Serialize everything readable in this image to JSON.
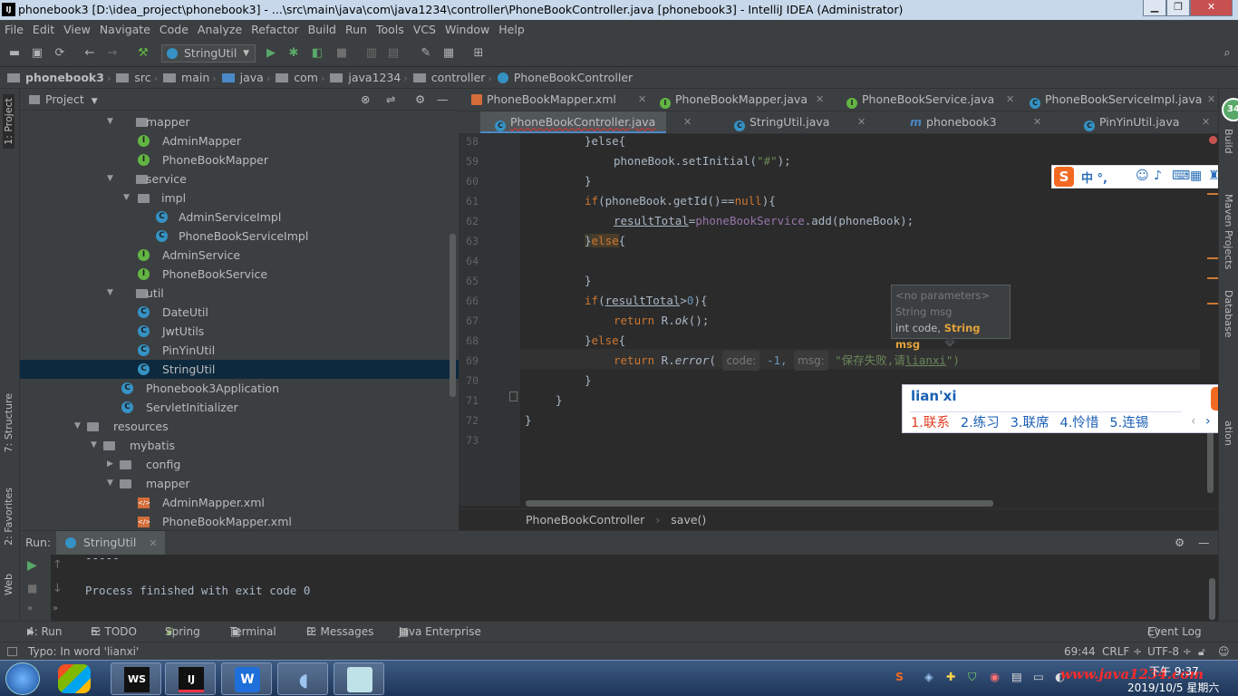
{
  "window": {
    "title": "phonebook3 [D:\\idea_project\\phonebook3] - ...\\src\\main\\java\\com\\java1234\\controller\\PhoneBookController.java [phonebook3] - IntelliJ IDEA (Administrator)"
  },
  "menu": [
    "File",
    "Edit",
    "View",
    "Navigate",
    "Code",
    "Analyze",
    "Refactor",
    "Build",
    "Run",
    "Tools",
    "VCS",
    "Window",
    "Help"
  ],
  "toolbar": {
    "run_config": "StringUtil"
  },
  "navbar": [
    "phonebook3",
    "src",
    "main",
    "java",
    "com",
    "java1234",
    "controller",
    "PhoneBookController"
  ],
  "left_strip": {
    "project": "1: Project",
    "structure": "7: Structure",
    "favorites": "2: Favorites",
    "web": "Web"
  },
  "right_strip": {
    "build": "Build",
    "maven": "Maven Projects",
    "database": "Database",
    "badge": "34",
    "other": "ation"
  },
  "project": {
    "header": "Project",
    "tree": [
      {
        "label": "mapper",
        "kind": "folder"
      },
      {
        "label": "AdminMapper",
        "kind": "interface"
      },
      {
        "label": "PhoneBookMapper",
        "kind": "interface"
      },
      {
        "label": "service",
        "kind": "folder"
      },
      {
        "label": "impl",
        "kind": "folder"
      },
      {
        "label": "AdminServiceImpl",
        "kind": "class"
      },
      {
        "label": "PhoneBookServiceImpl",
        "kind": "class"
      },
      {
        "label": "AdminService",
        "kind": "interface"
      },
      {
        "label": "PhoneBookService",
        "kind": "interface"
      },
      {
        "label": "util",
        "kind": "folder"
      },
      {
        "label": "DateUtil",
        "kind": "class"
      },
      {
        "label": "JwtUtils",
        "kind": "class"
      },
      {
        "label": "PinYinUtil",
        "kind": "class"
      },
      {
        "label": "StringUtil",
        "kind": "class"
      },
      {
        "label": "Phonebook3Application",
        "kind": "class"
      },
      {
        "label": "ServletInitializer",
        "kind": "class"
      },
      {
        "label": "resources",
        "kind": "folder"
      },
      {
        "label": "mybatis",
        "kind": "folder"
      },
      {
        "label": "config",
        "kind": "folder"
      },
      {
        "label": "mapper",
        "kind": "folder"
      },
      {
        "label": "AdminMapper.xml",
        "kind": "xml"
      },
      {
        "label": "PhoneBookMapper.xml",
        "kind": "xml"
      }
    ]
  },
  "tabs_row1": [
    {
      "label": "PhoneBookMapper.xml"
    },
    {
      "label": "PhoneBookMapper.java"
    },
    {
      "label": "PhoneBookService.java"
    },
    {
      "label": "PhoneBookServiceImpl.java"
    }
  ],
  "tabs_row2": [
    {
      "label": "PhoneBookController.java"
    },
    {
      "label": "StringUtil.java"
    },
    {
      "label": "phonebook3"
    },
    {
      "label": "PinYinUtil.java"
    }
  ],
  "code": {
    "line_numbers": [
      "58",
      "59",
      "60",
      "61",
      "62",
      "63",
      "64",
      "65",
      "66",
      "67",
      "68",
      "69",
      "70",
      "71",
      "72",
      "73"
    ],
    "l58": "}else{",
    "l59_a": "phoneBook.setInitial(",
    "l59_s": "\"#\"",
    "l59_b": ");",
    "l60": "}",
    "l61_kw": "if",
    "l61_a": "(phoneBook.getId()==",
    "l61_null": "null",
    "l61_b": "){",
    "l62_f": "resultTotal",
    "l62_a": "=",
    "l62_f2": "phoneBookService",
    "l62_b": ".add(phoneBook);",
    "l63_a": "}",
    "l63_kw": "else",
    "l63_b": "{",
    "l65": "}",
    "l66_kw": "if",
    "l66_a": "(",
    "l66_f": "resultTotal",
    "l66_b": ">",
    "l66_n": "0",
    "l66_c": "){",
    "l67_kw": "return",
    "l67_a": " R.",
    "l67_m": "ok",
    "l67_b": "();",
    "l68_a": "}",
    "l68_kw": "else",
    "l68_b": "{",
    "l69_kw": "return",
    "l69_a": " R.",
    "l69_m": "error",
    "l69_b": "( ",
    "l69_h1": "code:",
    "l69_n": " -1, ",
    "l69_h2": "msg:",
    "l69_s": " \"保存失败,请",
    "l69_s2": "lianxi",
    "l69_s3": "\")",
    "l70": "}",
    "l71": "}",
    "l72": "}"
  },
  "param_popup": {
    "line1": "<no parameters>",
    "line2": "String msg",
    "line3_a": "int code, ",
    "line3_b": "String msg"
  },
  "editor_breadcrumb": {
    "class": "PhoneBookController",
    "method": "save()"
  },
  "ime": {
    "input": "lian'xi",
    "candidates": [
      "1.联系",
      "2.练习",
      "3.联席",
      "4.怜惜",
      "5.连锡"
    ],
    "bar": "中 °,"
  },
  "run": {
    "label": "Run:",
    "tab": "StringUtil",
    "output_top": "-----",
    "output": "Process finished with exit code 0"
  },
  "bottom_tabs": [
    "4: Run",
    "6: TODO",
    "Spring",
    "Terminal",
    "0: Messages",
    "Java Enterprise",
    "Event Log"
  ],
  "status": {
    "message": "Typo: In word 'lianxi'",
    "position": "69:44",
    "line_sep": "CRLF ÷",
    "encoding": "UTF-8 ÷"
  },
  "taskbar": {
    "time": "下午 9:37",
    "date": "2019/10/5 星期六",
    "watermark": "www.java1234.com"
  },
  "colors": {
    "accent": "#4a88c7",
    "selection": "#0d293e",
    "keyword": "#cc7832",
    "string": "#6a8759",
    "field": "#9876aa"
  }
}
